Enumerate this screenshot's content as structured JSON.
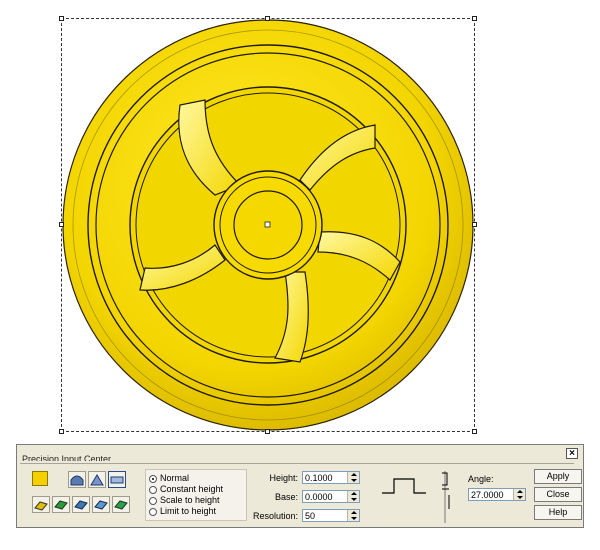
{
  "canvas": {
    "fill_color": "#f5d800",
    "edge_color": "#1f1a00"
  },
  "dialog": {
    "title": "Precision Input Center",
    "close_glyph": "×",
    "color_swatch": "#f5d000",
    "tool_icons_row1": [
      "dome-icon",
      "arch-icon",
      "flat-icon"
    ],
    "tool_icons_row2": [
      "layer-icon-1",
      "layer-icon-2",
      "layer-icon-3",
      "layer-icon-4",
      "layer-icon-5"
    ],
    "modes": [
      {
        "label": "Normal",
        "selected": true
      },
      {
        "label": "Constant height",
        "selected": false
      },
      {
        "label": "Scale to height",
        "selected": false
      },
      {
        "label": "Limit to height",
        "selected": false
      }
    ],
    "height_label": "Height:",
    "height_value": "0.1000",
    "base_label": "Base:",
    "base_value": "0.0000",
    "resolution_label": "Resolution:",
    "resolution_value": "50",
    "angle_label": "Angle:",
    "angle_value": "27.0000",
    "apply_label": "Apply",
    "close_label": "Close",
    "help_label": "Help"
  }
}
